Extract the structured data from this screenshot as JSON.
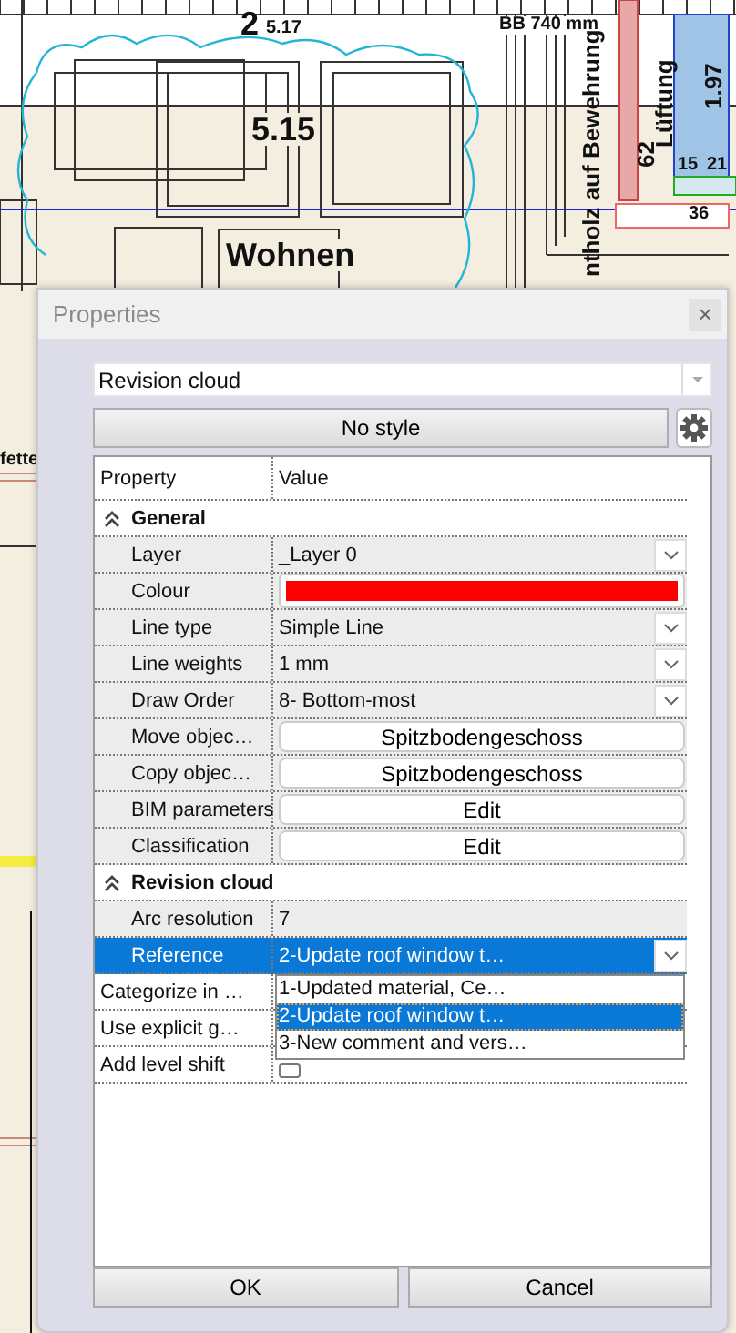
{
  "canvas": {
    "labels": [
      {
        "text": "2",
        "kind": "large"
      },
      {
        "text": "5.17",
        "kind": "small"
      },
      {
        "text": "BB 740 mm",
        "kind": "small"
      },
      {
        "text": "5.15",
        "kind": "large"
      },
      {
        "text": "Wohnen",
        "kind": "large"
      },
      {
        "text": "ntholz auf Bewehrung",
        "kind": "vertical"
      },
      {
        "text": "62",
        "kind": "vertical"
      },
      {
        "text": "Lüftung",
        "kind": "vertical"
      },
      {
        "text": "1.97",
        "kind": "vertical"
      },
      {
        "text": "15",
        "kind": "small"
      },
      {
        "text": "21",
        "kind": "small"
      },
      {
        "text": "36",
        "kind": "small"
      },
      {
        "text": "fette",
        "kind": "small"
      }
    ]
  },
  "dialog": {
    "title": "Properties",
    "close": "×",
    "object_type": "Revision cloud",
    "style_button": "No style",
    "grid": {
      "columns": [
        "Property",
        "Value"
      ],
      "groups": [
        {
          "name": "General",
          "expanded": true,
          "rows": [
            {
              "label": "Layer",
              "kind": "dropdown",
              "value": "_Layer 0",
              "selected": false
            },
            {
              "label": "Colour",
              "kind": "color",
              "color": "#ff0000",
              "selected": false
            },
            {
              "label": "Line type",
              "kind": "dropdown",
              "value": "Simple Line",
              "selected": false
            },
            {
              "label": "Line weights",
              "kind": "dropdown",
              "value": "1 mm",
              "selected": false
            },
            {
              "label": "Draw Order",
              "kind": "dropdown",
              "value": "8- Bottom-most",
              "selected": false
            },
            {
              "label": "Move objec…",
              "kind": "button",
              "value": "Spitzbodengeschoss",
              "selected": false
            },
            {
              "label": "Copy objec…",
              "kind": "button",
              "value": "Spitzbodengeschoss",
              "selected": false
            },
            {
              "label": "BIM parameters",
              "kind": "button",
              "value": "Edit",
              "selected": false
            },
            {
              "label": "Classification",
              "kind": "button",
              "value": "Edit",
              "selected": false
            }
          ]
        },
        {
          "name": "Revision cloud",
          "expanded": true,
          "rows": [
            {
              "label": "Arc resolution",
              "kind": "text",
              "value": "7",
              "selected": false
            },
            {
              "label": "Reference",
              "kind": "dropdown",
              "value": "2-Update roof window t…",
              "selected": true
            }
          ]
        }
      ],
      "extra_rows": [
        {
          "label": "Categorize in …",
          "kind": "plain",
          "selected": false
        },
        {
          "label": "Use explicit g…",
          "kind": "plain",
          "selected": false
        },
        {
          "label": "Add level shift",
          "kind": "checkbox",
          "checked": false,
          "selected": false
        }
      ]
    },
    "dropdown_list": {
      "options": [
        {
          "text": "1-Updated material, Ce…",
          "selected": false
        },
        {
          "text": "2-Update roof window t…",
          "selected": true
        },
        {
          "text": "3-New comment and vers…",
          "selected": false
        }
      ]
    },
    "buttons": [
      "OK",
      "Cancel"
    ]
  }
}
